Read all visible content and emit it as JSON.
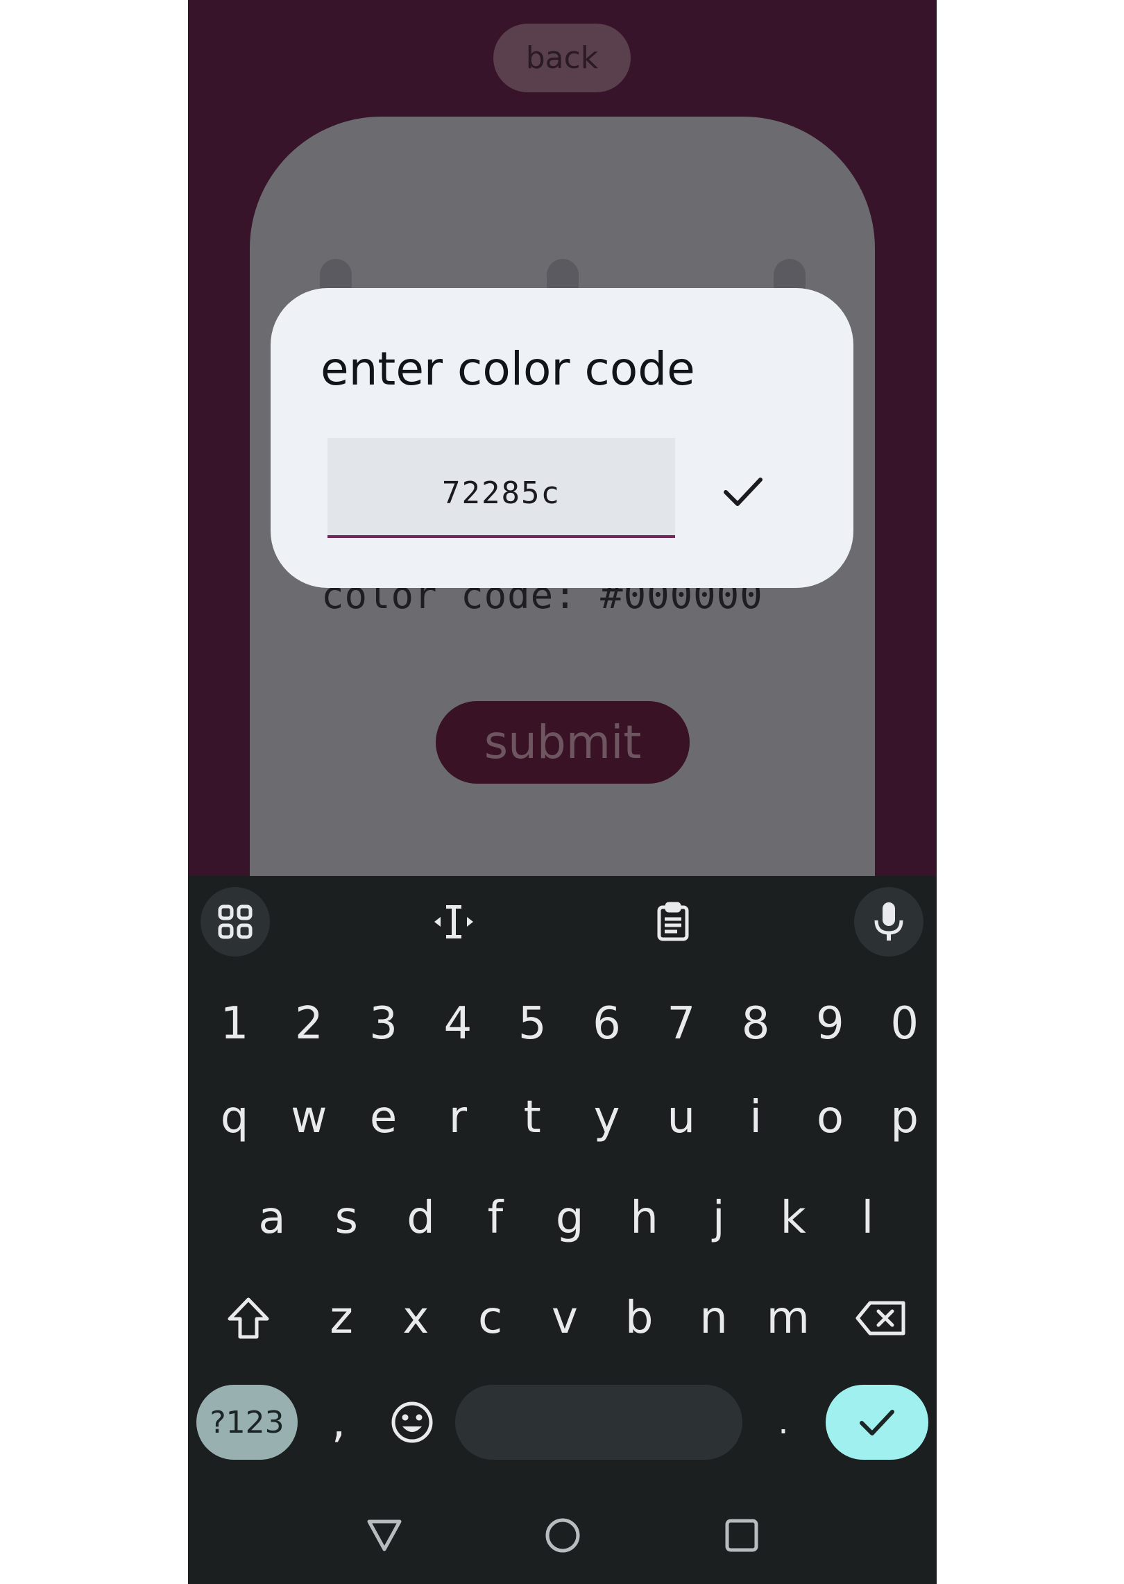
{
  "app": {
    "back_label": "back",
    "color_code_text": "color code: #000000",
    "submit_label": "submit"
  },
  "dialog": {
    "title": "enter color code",
    "input_value": "72285c",
    "accent_color": "#72285c"
  },
  "keyboard": {
    "toolbar": [
      "apps-grid-icon",
      "text-cursor-icon",
      "clipboard-icon",
      "microphone-icon"
    ],
    "number_row": [
      "1",
      "2",
      "3",
      "4",
      "5",
      "6",
      "7",
      "8",
      "9",
      "0"
    ],
    "row1": [
      "q",
      "w",
      "e",
      "r",
      "t",
      "y",
      "u",
      "i",
      "o",
      "p"
    ],
    "row2": [
      "a",
      "s",
      "d",
      "f",
      "g",
      "h",
      "j",
      "k",
      "l"
    ],
    "row3": [
      "z",
      "x",
      "c",
      "v",
      "b",
      "n",
      "m"
    ],
    "symbols_label": "?123",
    "comma": ",",
    "period": "."
  },
  "colors": {
    "app_background": "#37142a",
    "keyboard_background": "#1b1f20",
    "enter_key": "#9ff0ef"
  }
}
